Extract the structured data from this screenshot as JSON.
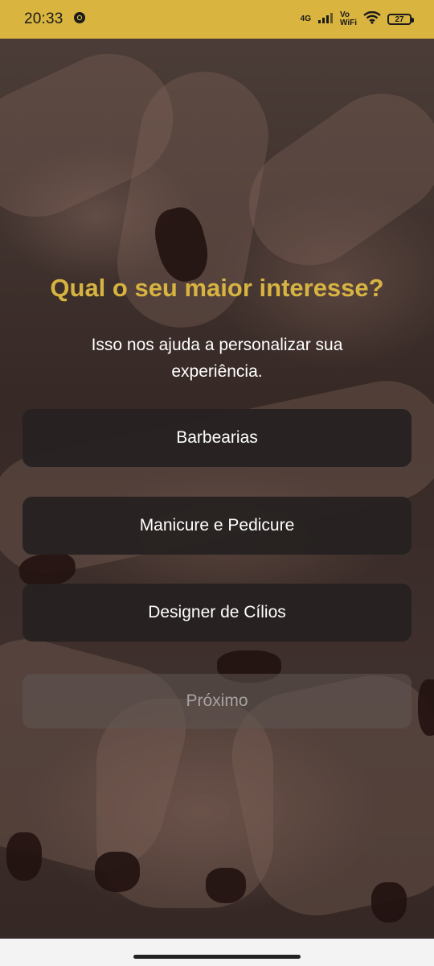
{
  "status_bar": {
    "time": "20:33",
    "network": "4G",
    "volte_top": "Vo",
    "volte_bottom": "WiFi",
    "battery": "27",
    "icons": [
      "chrome-icon",
      "signal-icon",
      "wifi-icon",
      "battery-icon"
    ]
  },
  "screen": {
    "title": "Qual o seu maior interesse?",
    "subtitle": "Isso nos ajuda a personalizar sua experiência.",
    "options": [
      {
        "label": "Barbearias"
      },
      {
        "label": "Manicure e Pedicure"
      },
      {
        "label": "Designer de Cílios"
      }
    ],
    "next_label": "Próximo"
  },
  "colors": {
    "accent": "#d7b441",
    "status_bar": "#d9b43f",
    "option_bg": "#262221",
    "disabled_text": "#a8a3a1"
  }
}
